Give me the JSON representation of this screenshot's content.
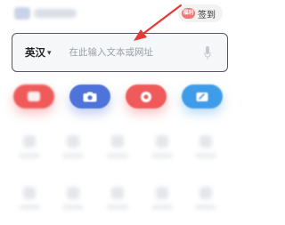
{
  "header": {
    "signin": {
      "icon_text": "福利",
      "label": "签到"
    }
  },
  "search": {
    "lang_label": "英汉",
    "lang_caret": "▾",
    "placeholder": "在此输入文本或网址"
  },
  "icons": {
    "mic": "microphone-icon",
    "tools": [
      "document-icon",
      "camera-icon",
      "voice-icon",
      "edit-icon"
    ]
  },
  "colors": {
    "accent_red": "#ef5a5a",
    "accent_blue": "#4f74d9",
    "accent_light_blue": "#3f9ce8",
    "arrow": "#e53935"
  }
}
